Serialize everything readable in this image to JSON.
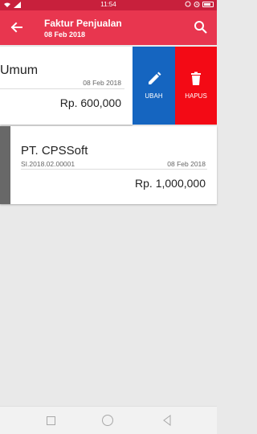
{
  "status_bar": {
    "time": "11:54",
    "icons_left": [
      "wifi-icon",
      "signal-icon"
    ],
    "icons_right": [
      "sync-icon",
      "alarm-icon",
      "battery-icon"
    ]
  },
  "app_bar": {
    "title": "Faktur Penjualan",
    "subtitle": "08 Feb 2018",
    "color": "#e8364f",
    "back_icon": "arrow-left-icon",
    "search_icon": "search-icon"
  },
  "invoices": [
    {
      "customer": "Umum",
      "date": "08 Feb 2018",
      "amount": "Rp. 600,000"
    },
    {
      "customer": "PT. CPSSoft",
      "code": "SI.2018.02.00001",
      "date": "08 Feb 2018",
      "amount": "Rp. 1,000,000"
    }
  ],
  "swipe_actions": {
    "edit_label": "UBAH",
    "edit_icon": "pencil-icon",
    "edit_color": "#1565c0",
    "delete_label": "HAPUS",
    "delete_icon": "trash-icon",
    "delete_color": "#f30a15"
  },
  "nav_bar": [
    "recents-icon",
    "home-icon",
    "back-triangle-icon"
  ]
}
